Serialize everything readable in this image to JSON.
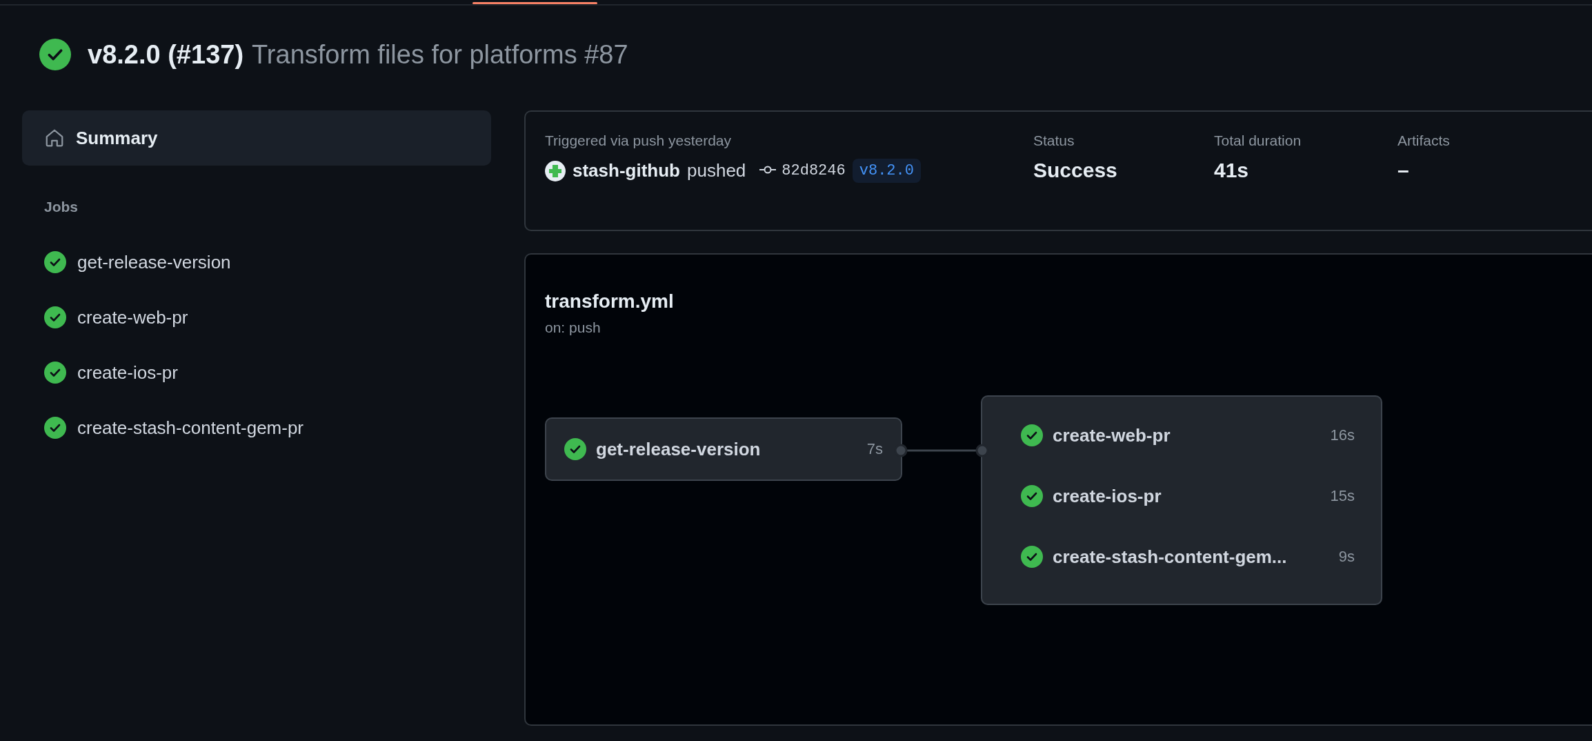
{
  "header": {
    "passed": true,
    "title": "v8.2.0 (#137)",
    "subtitle": "Transform files for platforms #87"
  },
  "sidebar": {
    "summary": {
      "label": "Summary",
      "selected": true
    },
    "jobs_heading": "Jobs",
    "jobs": [
      {
        "name": "get-release-version",
        "passed": true,
        "selected": false
      },
      {
        "name": "create-web-pr",
        "passed": true,
        "selected": false
      },
      {
        "name": "create-ios-pr",
        "passed": true,
        "selected": false
      },
      {
        "name": "create-stash-content-gem-pr",
        "passed": true,
        "selected": false
      }
    ]
  },
  "summary_card": {
    "trigger": "Triggered via push yesterday",
    "actor": "stash-github",
    "action": "pushed",
    "commit": "82d8246",
    "tag": "v8.2.0",
    "stats": [
      {
        "label": "Status",
        "value": "Success"
      },
      {
        "label": "Total duration",
        "value": "41s"
      },
      {
        "label": "Artifacts",
        "value": "–"
      }
    ]
  },
  "workflow": {
    "file": "transform.yml",
    "trigger": "on: push",
    "stages": [
      {
        "jobs": [
          {
            "name": "get-release-version",
            "passed": true,
            "duration": "7s"
          }
        ]
      },
      {
        "jobs": [
          {
            "name": "create-web-pr",
            "passed": true,
            "duration": "16s"
          },
          {
            "name": "create-ios-pr",
            "passed": true,
            "duration": "15s"
          },
          {
            "name": "create-stash-content-gem...",
            "passed": true,
            "duration": "9s"
          }
        ]
      }
    ]
  }
}
